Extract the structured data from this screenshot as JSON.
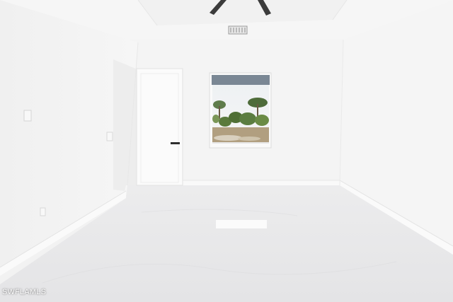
{
  "watermark": "SWFLAMLS",
  "colors": {
    "wall": "#f4f4f4",
    "ceiling": "#f7f7f7",
    "floor": "#e9e9ea",
    "trim": "#fafafa",
    "door": "#fbfbfb",
    "fan_blade": "#3b3b3b"
  },
  "objects": [
    "ceiling-fan",
    "air-vent",
    "interior-door",
    "window",
    "baseboards",
    "light-switch",
    "outlet",
    "tile-floor"
  ]
}
